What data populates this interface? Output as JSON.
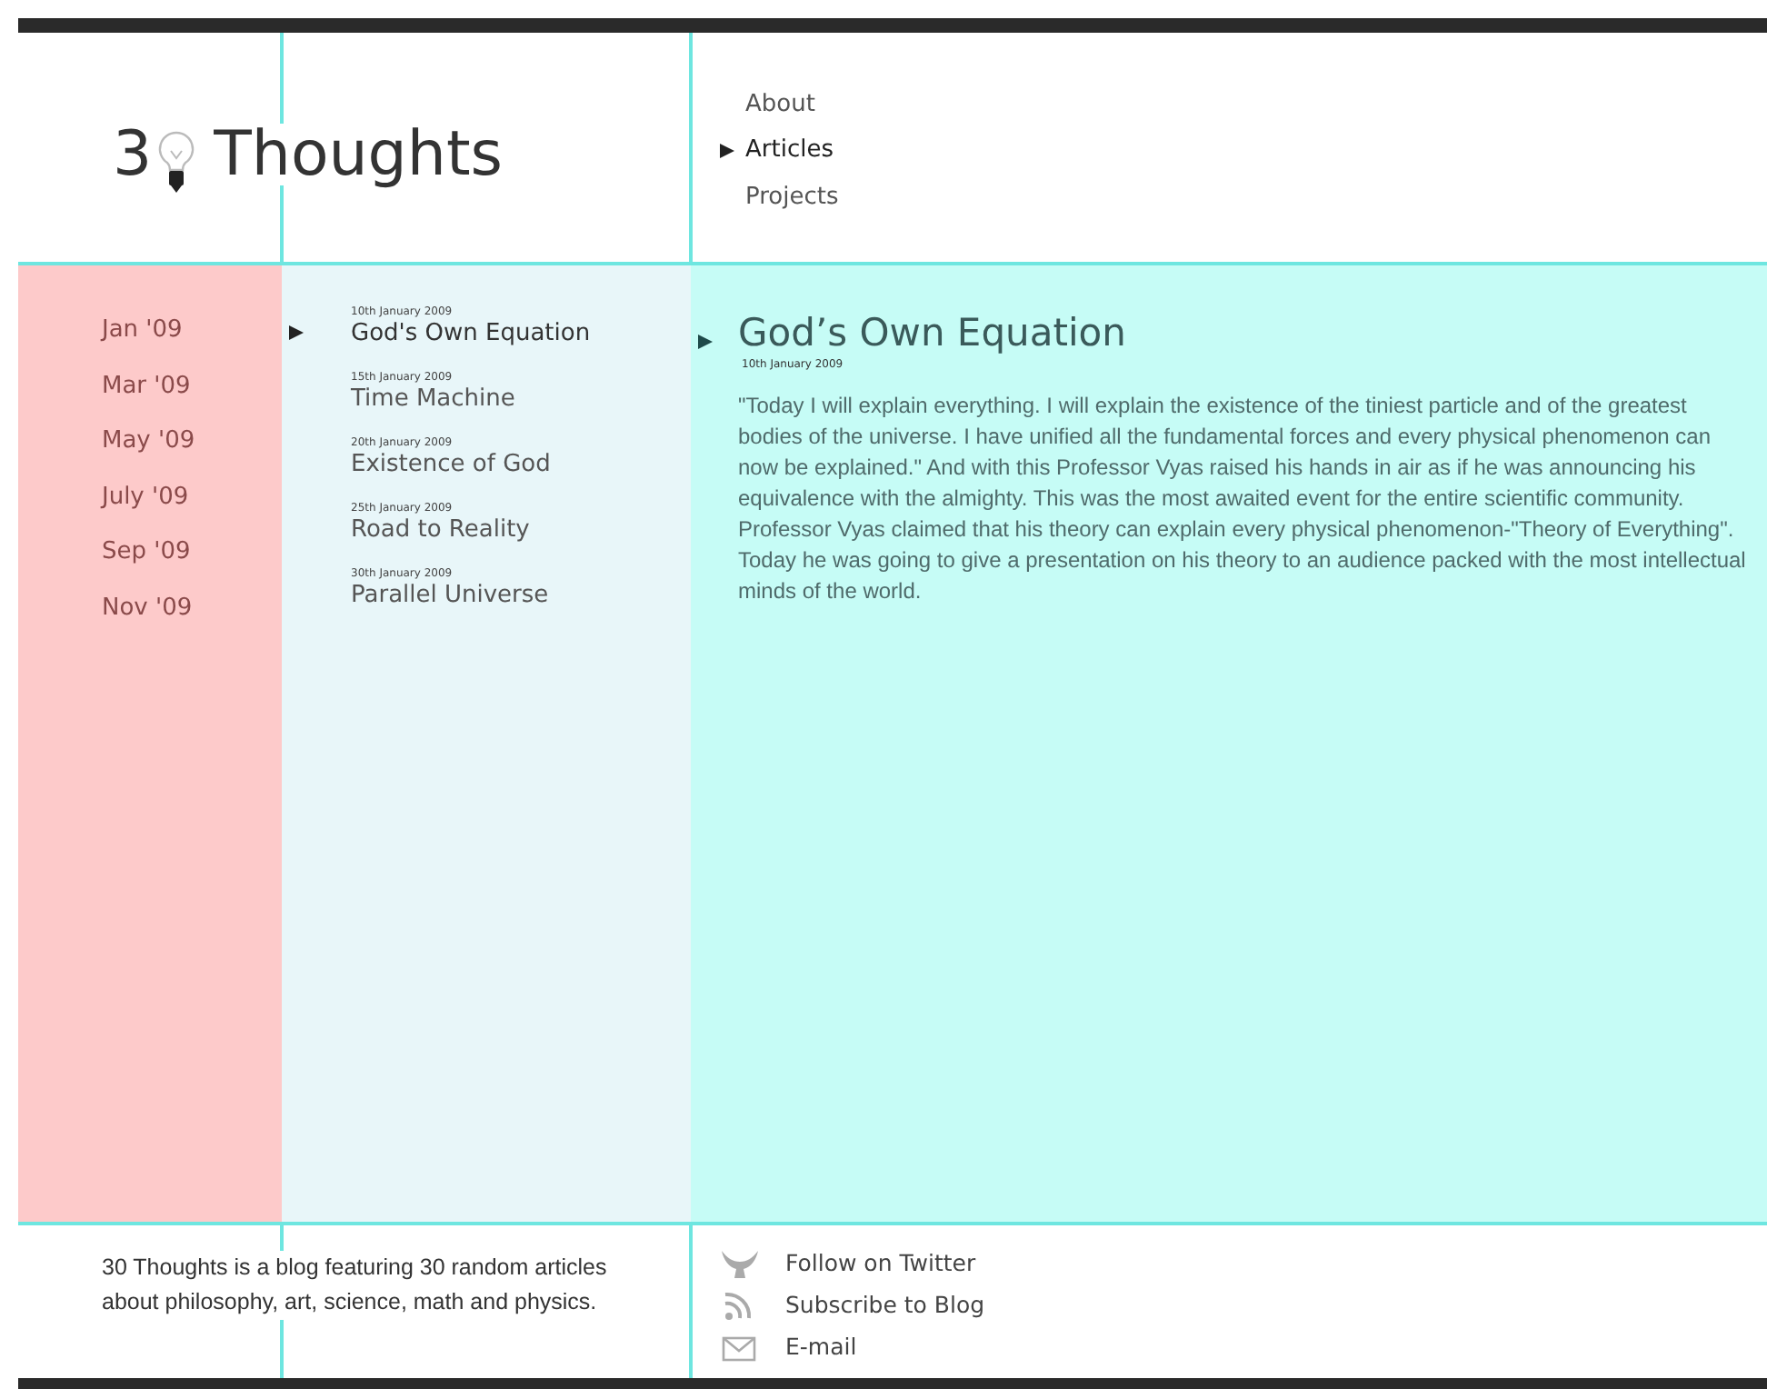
{
  "logo": {
    "first": "3",
    "rest": "Thoughts"
  },
  "nav": [
    {
      "label": "About",
      "selected": false
    },
    {
      "label": "Articles",
      "selected": true
    },
    {
      "label": "Projects",
      "selected": false
    }
  ],
  "months": [
    "Jan '09",
    "Mar '09",
    "May '09",
    "July '09",
    "Sep '09",
    "Nov '09"
  ],
  "articles": [
    {
      "date": "10th January 2009",
      "title": "God's Own Equation",
      "selected": true
    },
    {
      "date": "15th January 2009",
      "title": "Time Machine",
      "selected": false
    },
    {
      "date": "20th January 2009",
      "title": "Existence of God",
      "selected": false
    },
    {
      "date": "25th January 2009",
      "title": "Road to Reality",
      "selected": false
    },
    {
      "date": "30th January 2009",
      "title": "Parallel Universe",
      "selected": false
    }
  ],
  "post": {
    "title": "God’s Own Equation",
    "date": "10th January 2009",
    "body": "\"Today I will explain everything. I will explain the existence of the tiniest particle and of the greatest bodies of the universe. I have unified all the fundamental forces and every physical phenomenon can now be explained.\" And with this Professor Vyas raised his hands in air as if he was announcing his equivalence with the almighty. This was the most awaited event for the entire scientific community. Professor Vyas claimed that his theory can explain every physical phenomenon-\"Theory of Everything\". Today he was going to give a presentation on his theory to an audience packed with the most intellectual minds of the world."
  },
  "footer": {
    "about": "30 Thoughts is a blog featuring 30 random articles about philosophy, art, science, math and physics.",
    "links": [
      {
        "kind": "twitter",
        "label": "Follow on Twitter"
      },
      {
        "kind": "rss",
        "label": "Subscribe to Blog"
      },
      {
        "kind": "email",
        "label": "E-mail"
      }
    ]
  }
}
